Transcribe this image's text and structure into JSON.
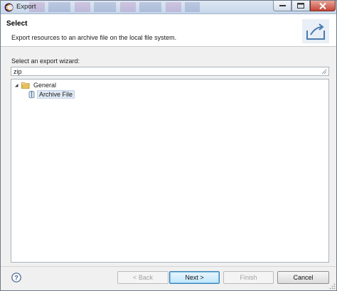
{
  "window": {
    "title": "Export"
  },
  "header": {
    "title": "Select",
    "description": "Export resources to an archive file on the local file system."
  },
  "wizard": {
    "label": "Select an export wizard:",
    "filter_value": "zip",
    "tree": [
      {
        "label": "General",
        "expanded": true,
        "children": [
          {
            "label": "Archive File",
            "selected": true
          }
        ]
      }
    ]
  },
  "buttons": {
    "back": "< Back",
    "next": "Next >",
    "finish": "Finish",
    "cancel": "Cancel"
  },
  "icons": {
    "app": "eclipse-icon",
    "header": "export-tray-icon",
    "folder": "folder-icon",
    "archive": "jar-file-icon",
    "help": "help-icon"
  },
  "colors": {
    "selection": "#dfe8f4",
    "default_button": "#3c7fb1",
    "folder": "#e8c35a"
  }
}
